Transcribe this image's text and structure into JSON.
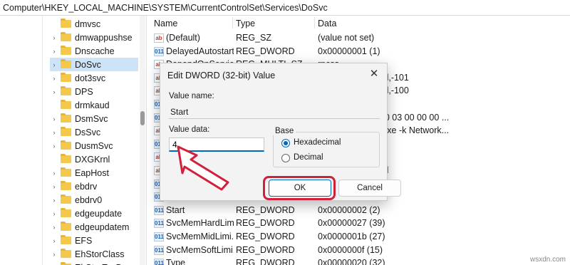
{
  "address": "Computer\\HKEY_LOCAL_MACHINE\\SYSTEM\\CurrentControlSet\\Services\\DoSvc",
  "tree": {
    "items": [
      {
        "label": "dmvsc",
        "chevron": ""
      },
      {
        "label": "dmwappushse",
        "chevron": "›"
      },
      {
        "label": "Dnscache",
        "chevron": "›"
      },
      {
        "label": "DoSvc",
        "chevron": "›"
      },
      {
        "label": "dot3svc",
        "chevron": "›"
      },
      {
        "label": "DPS",
        "chevron": "›"
      },
      {
        "label": "drmkaud",
        "chevron": ""
      },
      {
        "label": "DsmSvc",
        "chevron": "›"
      },
      {
        "label": "DsSvc",
        "chevron": "›"
      },
      {
        "label": "DusmSvc",
        "chevron": "›"
      },
      {
        "label": "DXGKrnl",
        "chevron": ""
      },
      {
        "label": "EapHost",
        "chevron": "›"
      },
      {
        "label": "ebdrv",
        "chevron": "›"
      },
      {
        "label": "ebdrv0",
        "chevron": "›"
      },
      {
        "label": "edgeupdate",
        "chevron": "›"
      },
      {
        "label": "edgeupdatem",
        "chevron": "›"
      },
      {
        "label": "EFS",
        "chevron": "›"
      },
      {
        "label": "EhStorClass",
        "chevron": "›"
      },
      {
        "label": "EhStorTcgDrv",
        "chevron": "›"
      }
    ]
  },
  "values": {
    "headers": {
      "name": "Name",
      "type": "Type",
      "data": "Data"
    },
    "rows": [
      {
        "name": "(Default)",
        "type": "REG_SZ",
        "data": "(value not set)",
        "icon": "ab"
      },
      {
        "name": "DelayedAutostart",
        "type": "REG_DWORD",
        "data": "0x00000001 (1)",
        "icon": "bin"
      },
      {
        "name": "DependOnService",
        "type": "REG_MULTI_SZ",
        "data": "rpcss",
        "icon": "ab"
      },
      {
        "name": "",
        "type": "",
        "data": "ystem32\\dosvc.dll,-101",
        "icon": "ab"
      },
      {
        "name": "",
        "type": "",
        "data": "ystem32\\dosvc.dll,-100",
        "icon": "ab"
      },
      {
        "name": "",
        "type": "",
        "data": "",
        "icon": "bin"
      },
      {
        "name": "",
        "type": "",
        "data": "00 00 00 00 00 00 03 00 00 00 ...",
        "icon": "bin"
      },
      {
        "name": "",
        "type": "",
        "data": "stem32\\svchost.exe -k Network...",
        "icon": "ab"
      },
      {
        "name": "",
        "type": "",
        "data": "",
        "icon": "bin"
      },
      {
        "name": "",
        "type": "",
        "data": "orkService",
        "icon": "ab"
      },
      {
        "name": "",
        "type": "",
        "data": "ystem32\\dosvc.dll",
        "icon": "ab"
      },
      {
        "name": "",
        "type": "",
        "data": "",
        "icon": "bin"
      },
      {
        "name": "",
        "type": "",
        "data": "",
        "icon": "bin"
      },
      {
        "name": "Start",
        "type": "REG_DWORD",
        "data": "0x00000002 (2)",
        "icon": "bin"
      },
      {
        "name": "SvcMemHardLimi...",
        "type": "REG_DWORD",
        "data": "0x00000027 (39)",
        "icon": "bin"
      },
      {
        "name": "SvcMemMidLimi...",
        "type": "REG_DWORD",
        "data": "0x0000001b (27)",
        "icon": "bin"
      },
      {
        "name": "SvcMemSoftLimi...",
        "type": "REG_DWORD",
        "data": "0x0000000f (15)",
        "icon": "bin"
      },
      {
        "name": "Type",
        "type": "REG_DWORD",
        "data": "0x00000020 (32)",
        "icon": "bin"
      }
    ]
  },
  "dialog": {
    "title": "Edit DWORD (32-bit) Value",
    "close": "✕",
    "value_name_label": "Value name:",
    "value_name": "Start",
    "value_data_label": "Value data:",
    "value_data": "4",
    "base_label": "Base",
    "hex_label": "Hexadecimal",
    "dec_label": "Decimal",
    "ok_label": "OK",
    "cancel_label": "Cancel"
  },
  "annotation_color": "#d21f3c",
  "watermark": "wsxdn.com"
}
